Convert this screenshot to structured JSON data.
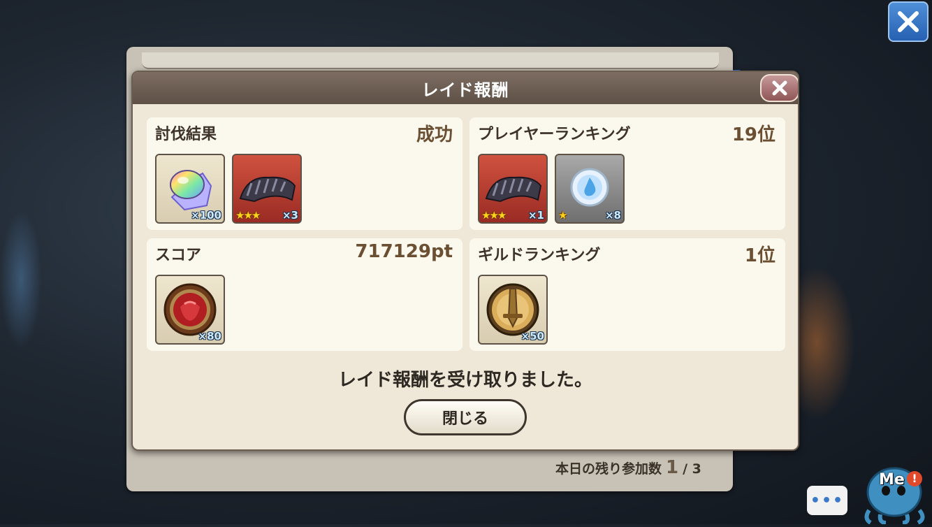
{
  "dialog": {
    "title": "レイド報酬"
  },
  "sections": {
    "subjugation": {
      "title": "討伐結果",
      "value": "成功"
    },
    "player_ranking": {
      "title": "プレイヤーランキング",
      "value": "19位"
    },
    "score": {
      "title": "スコア",
      "value": "717129pt"
    },
    "guild_ranking": {
      "title": "ギルドランキング",
      "value": "1位"
    }
  },
  "rewards": {
    "subjugation": [
      {
        "icon": "rainbow-crystal-icon",
        "qty": "×100",
        "stars": ""
      },
      {
        "icon": "dark-fur-icon",
        "qty": "×3",
        "stars": "★★★"
      }
    ],
    "player_ranking": [
      {
        "icon": "dark-fur-icon",
        "qty": "×1",
        "stars": "★★★"
      },
      {
        "icon": "water-orb-icon",
        "qty": "×8",
        "stars": "★"
      }
    ],
    "score": [
      {
        "icon": "red-gem-medal-icon",
        "qty": "×80",
        "stars": ""
      }
    ],
    "guild_ranking": [
      {
        "icon": "sword-medal-icon",
        "qty": "×50",
        "stars": ""
      }
    ]
  },
  "message": "レイド報酬を受け取りました。",
  "close_button": "閉じる",
  "participation": {
    "label": "本日の残り参加数",
    "current": "1",
    "total": "/ 3"
  },
  "mascot": {
    "label": "Me",
    "badge": "!"
  },
  "chat": {
    "label": "•••"
  },
  "colors": {
    "header": "#5e5046",
    "accent_blue": "#2660b2",
    "card": "#fbf8ee"
  }
}
